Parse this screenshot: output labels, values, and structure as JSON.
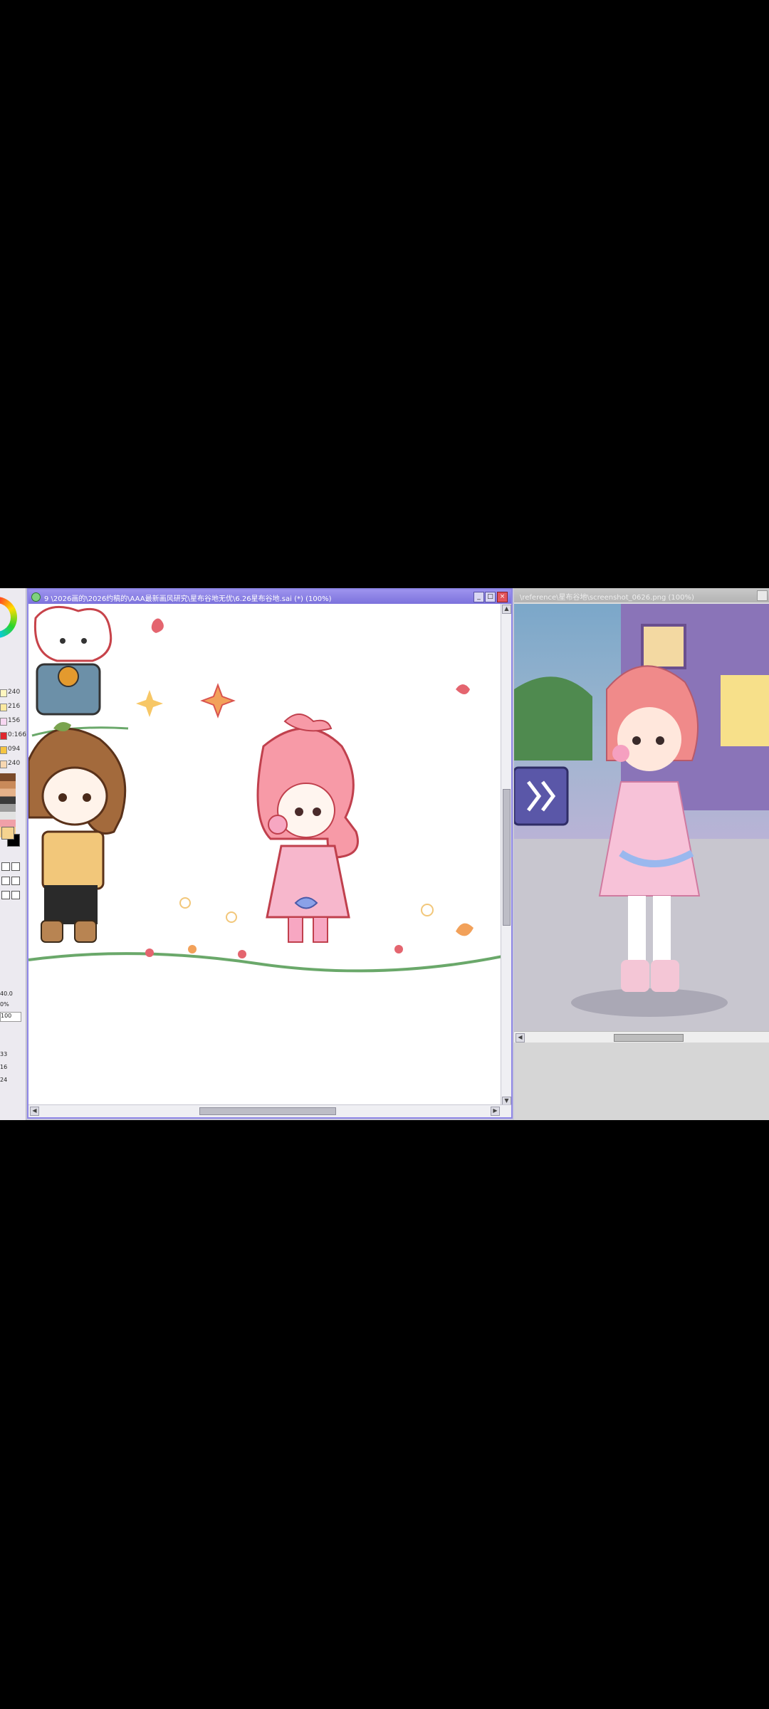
{
  "toolpanel": {
    "color_values": [
      "240",
      "216",
      "156",
      "0:166",
      "094",
      "240"
    ],
    "brush_size": "40.0",
    "opacity_label": "100",
    "labels": [
      "0%",
      "33",
      "16",
      "24"
    ]
  },
  "canvas_window": {
    "title": "9 \\2026画的\\2026约稿的\\AAA最新画风研究\\星布谷地无优\\6.26星布谷地.sai (*) (100%)",
    "minimize_label": "_",
    "maximize_label": "□",
    "close_label": "×"
  },
  "reference_window": {
    "title": "\\reference\\星布谷地\\screenshot_0626.png (100%)"
  },
  "colors": {
    "accent": "#8e86e6",
    "titlebar": "#7c72dc",
    "close": "#e2525a",
    "background": "#000000"
  }
}
